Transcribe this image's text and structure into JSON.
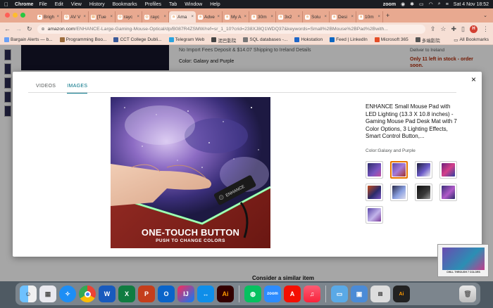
{
  "menubar": {
    "app": "Chrome",
    "items": [
      "File",
      "Edit",
      "View",
      "History",
      "Bookmarks",
      "Profiles",
      "Tab",
      "Window",
      "Help"
    ],
    "zoom_label": "zoom",
    "datetime": "Sat 4 Nov  18:52"
  },
  "tabs": [
    {
      "label": "Brigh",
      "icon": "bulb-icon"
    },
    {
      "label": "AV V",
      "icon": "globe-icon"
    },
    {
      "label": "[Tue",
      "icon": "doc-icon"
    },
    {
      "label": "rayc",
      "icon": "globe-icon"
    },
    {
      "label": "rayc",
      "icon": "globe-icon"
    },
    {
      "label": "Ama",
      "icon": "amazon-icon",
      "active": true
    },
    {
      "label": "Adve",
      "icon": "amazon-icon"
    },
    {
      "label": "My A",
      "icon": "amazon-icon"
    },
    {
      "label": "30m",
      "icon": "amazon-icon"
    },
    {
      "label": "3x2",
      "icon": "amazon-icon"
    },
    {
      "label": "Solu",
      "icon": "amazon-icon"
    },
    {
      "label": "Desi",
      "icon": "amazon-icon"
    },
    {
      "label": "10m",
      "icon": "amazon-icon"
    }
  ],
  "address": {
    "host": "amazon.com",
    "path": "/ENHANCE-Large-Gaming-Mouse-Optical/dp/B087R4ZSMW/ref=sr_1_10?crid=238XJ8Q1WDQ37&keywords=Small%2BMouse%2BPad%2Bwith...",
    "profile_initial": "H"
  },
  "bookmarks": [
    "Bargain Alerts — b...",
    "Programming Boo...",
    "CCT College Dubli...",
    "Telegram Web",
    "泥巴影院",
    "SQL databases -...",
    "Hokstation",
    "Feed | LinkedIn",
    "Microsoft 365",
    "多端影院"
  ],
  "all_bookmarks": "All Bookmarks",
  "background_page": {
    "shipping": "No Import Fees Deposit & $14.07 Shipping to Ireland Details",
    "color_line": "Color: Galaxy and Purple",
    "deliver": "Deliver to Ireland",
    "stock": "Only 11 left in stock - order soon.",
    "consider": "Consider a similar item"
  },
  "modal": {
    "tabs": [
      "VIDEOS",
      "IMAGES"
    ],
    "active_tab": "IMAGES",
    "close_label": "×",
    "image_caption_big": "ONE-TOUCH BUTTON",
    "image_caption_small": "PUSH TO CHANGE COLORS",
    "product_title": "ENHANCE Small Mouse Pad with LED Lighting (13.3 X 10.8 inches) - Gaming Mouse Pad Desk Mat with 7 Color Options, 3 Lighting Effects, Smart Control Button,...",
    "color_label": "Color:Galaxy and Purple",
    "thumbnails": [
      "thumb-1",
      "thumb-2",
      "thumb-3",
      "thumb-4",
      "thumb-5",
      "thumb-6",
      "thumb-7",
      "thumb-8",
      "thumb-9"
    ],
    "selected_thumbnail": 1
  },
  "floating_video": {
    "label": "CHILL THROUGH 7 COLORS"
  },
  "dock": [
    "finder-icon",
    "launchpad-icon",
    "safari-icon",
    "chrome-icon",
    "word-icon",
    "excel-icon",
    "powerpoint-icon",
    "outlook-icon",
    "intellij-icon",
    "teamviewer-icon",
    "illustrator-icon",
    "wechat-icon",
    "zoom-icon",
    "acrobat-icon",
    "music-icon",
    "folder-icon",
    "preview-icon",
    "window-thumb-icon",
    "trash-icon"
  ],
  "dock_labels": {
    "illustrator": "Ai",
    "zoom": "zoom",
    "word": "W",
    "excel": "X",
    "powerpoint": "P",
    "outlook": "O",
    "teamviewer": "↔"
  },
  "colors": {
    "accent_orange": "#e77600",
    "link_teal": "#007185",
    "stock_red": "#b12704",
    "tabbar": "#e8a990"
  }
}
